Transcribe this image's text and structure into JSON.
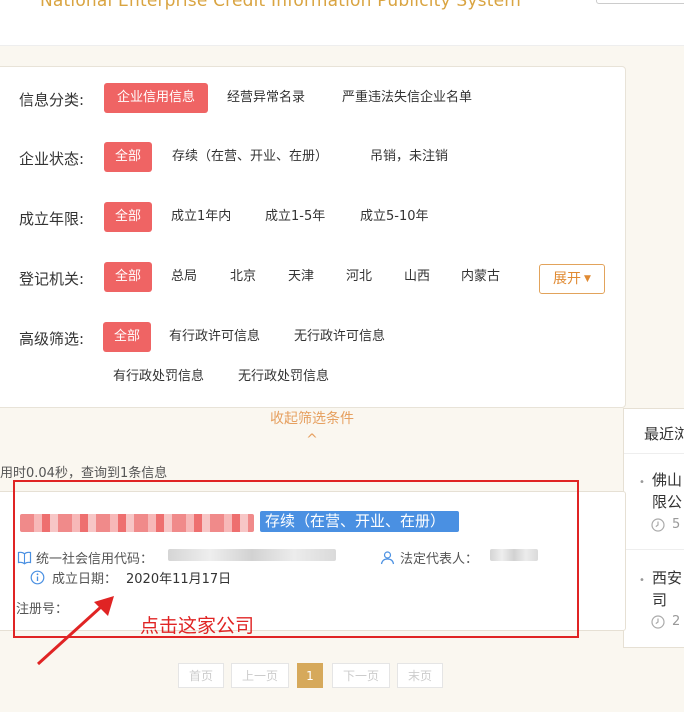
{
  "header": {
    "subtitle": "National Enterprise Credit Information Publicity System"
  },
  "filters": {
    "info_category": {
      "label": "信息分类:",
      "options": [
        "企业信用信息",
        "经营异常名录",
        "严重违法失信企业名单"
      ]
    },
    "status": {
      "label": "企业状态:",
      "options": [
        "全部",
        "存续（在营、开业、在册）",
        "吊销，未注销"
      ]
    },
    "age": {
      "label": "成立年限:",
      "options": [
        "全部",
        "成立1年内",
        "成立1-5年",
        "成立5-10年"
      ]
    },
    "authority": {
      "label": "登记机关:",
      "options": [
        "全部",
        "总局",
        "北京",
        "天津",
        "河北",
        "山西",
        "内蒙古"
      ],
      "expand_label": "展开"
    },
    "advanced": {
      "label": "高级筛选:",
      "options": [
        "全部",
        "有行政许可信息",
        "无行政许可信息",
        "有行政处罚信息",
        "无行政处罚信息"
      ]
    },
    "collapse_label": "收起筛选条件^"
  },
  "results": {
    "stats": "用时0.04秒，查询到1条信息",
    "item": {
      "status": "存续（在营、开业、在册）",
      "credit_code_label": "统一社会信用代码：",
      "legal_rep_label": "法定代表人：",
      "founded_label": "成立日期：",
      "founded_value": "2020年11月17日",
      "reg_no_label": "注册号："
    }
  },
  "recent": {
    "title": "最近浏",
    "items": [
      {
        "line1": "佛山",
        "line2": "限公",
        "sub": "5"
      },
      {
        "line1": "西安",
        "line2": "司",
        "sub": "2"
      }
    ]
  },
  "annotation": {
    "text": "点击这家公司",
    "color": "#e02424"
  },
  "pagination": {
    "first": "首页",
    "prev": "上一页",
    "current": "1",
    "next": "下一页",
    "last": "末页"
  },
  "colors": {
    "active_chip": "#ef6464",
    "status_badge": "#4a90e2",
    "accent": "#e08a32",
    "page_active": "#d6a95b"
  }
}
